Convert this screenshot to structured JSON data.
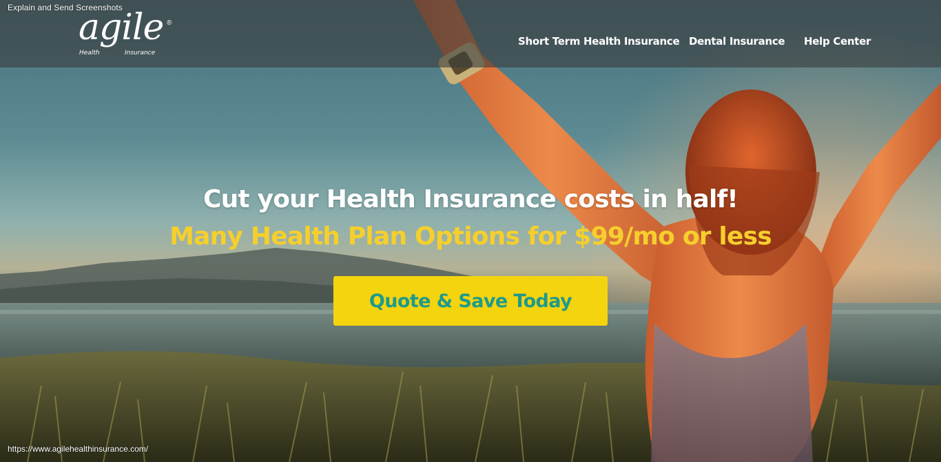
{
  "extension": {
    "label": "Explain and Send Screenshots",
    "url": "https://www.agilehealthinsurance.com/"
  },
  "brand": {
    "name": "agile",
    "registered_mark": "®",
    "tagline_left": "Health",
    "tagline_right": "Insurance"
  },
  "nav": {
    "items": [
      {
        "label": "Short Term Health Insurance"
      },
      {
        "label": "Dental Insurance"
      },
      {
        "label": "Help Center"
      }
    ]
  },
  "hero": {
    "headline": "Cut your Health Insurance costs in half!",
    "subheadline": "Many Health Plan Options for $99/mo or less",
    "cta_label": "Quote & Save Today"
  },
  "colors": {
    "accent_yellow": "#f4d40e",
    "subheadline_yellow": "#f6cf2c",
    "cta_text_teal": "#1f9a8a"
  }
}
